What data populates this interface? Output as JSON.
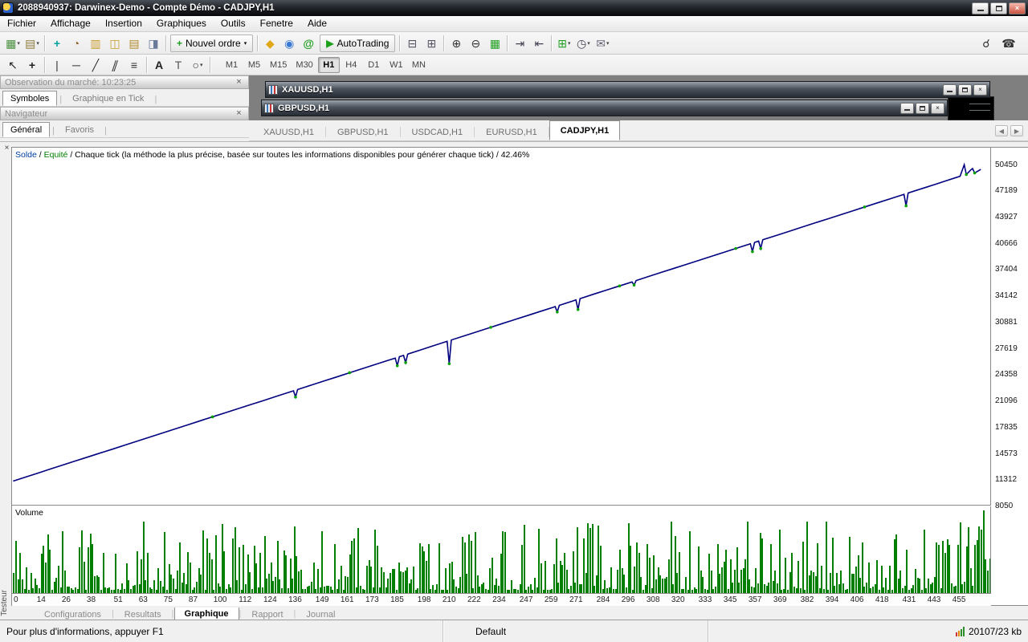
{
  "window": {
    "title": "2088940937: Darwinex-Demo - Compte Démo - CADJPY,H1"
  },
  "menu": {
    "items": [
      "Fichier",
      "Affichage",
      "Insertion",
      "Graphiques",
      "Outils",
      "Fenetre",
      "Aide"
    ]
  },
  "toolbar_main": {
    "items": [
      {
        "icon": "new-chart-icon",
        "glyph": "▦",
        "color": "#4a8f3f",
        "caret": true
      },
      {
        "icon": "profiles-icon",
        "glyph": "▤",
        "color": "#8a7a3a",
        "caret": true
      },
      {
        "sep": true
      },
      {
        "icon": "crosshair-icon",
        "glyph": "+",
        "color": "#00a0a0",
        "bold": true
      },
      {
        "icon": "compass-icon",
        "glyph": "◔",
        "color": "#996633"
      },
      {
        "icon": "market-watch-icon",
        "glyph": "▥",
        "color": "#c89a2a"
      },
      {
        "icon": "data-window-icon",
        "glyph": "◫",
        "color": "#c89a2a"
      },
      {
        "icon": "navigator-icon",
        "glyph": "▤",
        "color": "#b0882a"
      },
      {
        "icon": "terminal-icon",
        "glyph": "◨",
        "color": "#6a7a9a"
      },
      {
        "sep": true
      },
      {
        "button": "new_order"
      },
      {
        "sep": true
      },
      {
        "icon": "metaeditor-icon",
        "glyph": "◆",
        "color": "#e0a818"
      },
      {
        "icon": "community-icon",
        "glyph": "◉",
        "color": "#3a78d8"
      },
      {
        "icon": "scripts-icon",
        "glyph": "@",
        "color": "#22a022",
        "bold": true
      },
      {
        "button": "autotrading"
      },
      {
        "sep": true
      },
      {
        "icon": "tile-horizontal-icon",
        "glyph": "⊟",
        "color": "#556"
      },
      {
        "icon": "tile-vertical-icon",
        "glyph": "⊞",
        "color": "#556"
      },
      {
        "sep": true
      },
      {
        "icon": "zoom-in-icon",
        "glyph": "⊕",
        "color": "#333"
      },
      {
        "icon": "zoom-out-icon",
        "glyph": "⊖",
        "color": "#333"
      },
      {
        "icon": "maximize-chart-icon",
        "glyph": "▦",
        "color": "#22a022"
      },
      {
        "sep": true
      },
      {
        "icon": "chart-shift-icon",
        "glyph": "⇥",
        "color": "#445"
      },
      {
        "icon": "auto-scroll-icon",
        "glyph": "⇤",
        "color": "#445"
      },
      {
        "sep": true
      },
      {
        "icon": "add-indicator-icon",
        "glyph": "⊞",
        "color": "#22a022",
        "caret": true
      },
      {
        "icon": "periods-icon",
        "glyph": "◷",
        "color": "#445",
        "caret": true
      },
      {
        "icon": "mail-icon",
        "glyph": "✉",
        "color": "#667",
        "caret": true
      }
    ],
    "buttons": {
      "new_order": {
        "name": "new-order-button",
        "icon": "plus-icon",
        "glyph": "+",
        "icon_color": "#1f9e1f",
        "label": "Nouvel ordre",
        "caret": true
      },
      "autotrading": {
        "name": "autotrading-button",
        "icon": "play-icon",
        "glyph": "▶",
        "icon_color": "#1da11d",
        "label": "AutoTrading",
        "caret": false
      }
    },
    "right_icons": [
      {
        "icon": "search-icon",
        "glyph": "☌",
        "color": "#333"
      },
      {
        "icon": "support-phone-icon",
        "glyph": "☎",
        "color": "#333"
      }
    ]
  },
  "toolbar_draw": {
    "tools": [
      {
        "icon": "cursor-icon",
        "glyph": "↖",
        "color": "#222"
      },
      {
        "icon": "crosshair-tool-icon",
        "glyph": "+",
        "color": "#222",
        "bold": true
      },
      {
        "sep": true
      },
      {
        "icon": "vertical-line-icon",
        "glyph": "|",
        "color": "#333"
      },
      {
        "icon": "horizontal-line-icon",
        "glyph": "─",
        "color": "#333"
      },
      {
        "icon": "trendline-icon",
        "glyph": "╱",
        "color": "#333"
      },
      {
        "icon": "channel-icon",
        "glyph": "∥",
        "color": "#333",
        "skew": true
      },
      {
        "icon": "fibonacci-icon",
        "glyph": "≡",
        "color": "#333"
      },
      {
        "sep": true
      },
      {
        "icon": "text-icon",
        "glyph": "A",
        "color": "#222",
        "bold": true
      },
      {
        "icon": "label-icon",
        "glyph": "T",
        "color": "#555"
      },
      {
        "icon": "shapes-icon",
        "glyph": "○",
        "color": "#333",
        "caret": true
      },
      {
        "sep": true
      }
    ],
    "timeframes": [
      "M1",
      "M5",
      "M15",
      "M30",
      "H1",
      "H4",
      "D1",
      "W1",
      "MN"
    ],
    "active_timeframe": "H1"
  },
  "market_watch": {
    "title": "Observation du marché: 10:23:25",
    "tabs": [
      "Symboles",
      "Graphique en Tick"
    ],
    "active_tab": "Symboles"
  },
  "navigator": {
    "title": "Navigateur",
    "tabs": [
      "Général",
      "Favoris"
    ],
    "active_tab": "Général"
  },
  "mdi": {
    "windows": [
      {
        "title": "XAUUSD,H1"
      },
      {
        "title": "GBPUSD,H1"
      }
    ]
  },
  "chart_tabs": {
    "tabs": [
      "XAUUSD,H1",
      "GBPUSD,H1",
      "USDCAD,H1",
      "EURUSD,H1",
      "CADJPY,H1"
    ],
    "active": "CADJPY,H1"
  },
  "tester": {
    "panel_label": "Testeur",
    "header_segments": [
      {
        "text": "Solde",
        "color": "#0040a0"
      },
      {
        "text": " / ",
        "color": "#000000"
      },
      {
        "text": "Equité",
        "color": "#008000"
      },
      {
        "text": " / Chaque tick (la méthode la plus précise, basée sur toutes les informations disponibles pour générer chaque tick) / 42.46%",
        "color": "#000000"
      }
    ],
    "volume_label": "Volume",
    "tabs": [
      "Configurations",
      "Resultats",
      "Graphique",
      "Rapport",
      "Journal"
    ],
    "active_tab": "Graphique"
  },
  "chart_data": {
    "type": "line",
    "title": "Solde / Equité / Chaque tick (la méthode la plus précise, basée sur toutes les informations disponibles pour générer chaque tick) / 42.46%",
    "legend": false,
    "grid": false,
    "xlim": [
      0,
      470
    ],
    "ylim": [
      8050,
      52500
    ],
    "x_ticks": [
      0,
      14,
      26,
      38,
      51,
      63,
      75,
      87,
      100,
      112,
      124,
      136,
      149,
      161,
      173,
      185,
      198,
      210,
      222,
      234,
      247,
      259,
      271,
      284,
      296,
      308,
      320,
      333,
      345,
      357,
      369,
      382,
      394,
      406,
      418,
      431,
      443,
      455
    ],
    "y_ticks": [
      50450,
      47189,
      43927,
      40666,
      37404,
      34142,
      30881,
      27619,
      24358,
      21096,
      17835,
      14573,
      11312,
      8050
    ],
    "series": [
      {
        "name": "Solde",
        "color": "#00007f",
        "points": [
          [
            0,
            11000
          ],
          [
            6,
            11500
          ],
          [
            12,
            12000
          ],
          [
            18,
            12500
          ],
          [
            24,
            13000
          ],
          [
            30,
            13500
          ],
          [
            36,
            14000
          ],
          [
            42,
            14500
          ],
          [
            48,
            14990
          ],
          [
            54,
            15490
          ],
          [
            60,
            15990
          ],
          [
            66,
            16490
          ],
          [
            72,
            16990
          ],
          [
            78,
            17490
          ],
          [
            84,
            17990
          ],
          [
            90,
            18490
          ],
          [
            96,
            18990
          ],
          [
            102,
            19490
          ],
          [
            108,
            19990
          ],
          [
            114,
            20490
          ],
          [
            120,
            20980
          ],
          [
            126,
            21480
          ],
          [
            132,
            21980
          ],
          [
            135,
            22230
          ],
          [
            136,
            21450
          ],
          [
            137,
            22400
          ],
          [
            144,
            22980
          ],
          [
            150,
            23480
          ],
          [
            156,
            23980
          ],
          [
            162,
            24480
          ],
          [
            168,
            24980
          ],
          [
            174,
            25480
          ],
          [
            180,
            25980
          ],
          [
            184,
            26310
          ],
          [
            185,
            25350
          ],
          [
            186,
            26480
          ],
          [
            188,
            26640
          ],
          [
            189,
            25750
          ],
          [
            190,
            26810
          ],
          [
            196,
            27310
          ],
          [
            202,
            27810
          ],
          [
            208,
            28310
          ],
          [
            209,
            28390
          ],
          [
            210,
            25600
          ],
          [
            211,
            28560
          ],
          [
            218,
            29140
          ],
          [
            224,
            29640
          ],
          [
            230,
            30140
          ],
          [
            236,
            30640
          ],
          [
            242,
            31130
          ],
          [
            248,
            31630
          ],
          [
            254,
            32130
          ],
          [
            260,
            32630
          ],
          [
            261,
            32720
          ],
          [
            262,
            32050
          ],
          [
            263,
            32880
          ],
          [
            270,
            33460
          ],
          [
            271,
            33550
          ],
          [
            272,
            32350
          ],
          [
            273,
            33710
          ],
          [
            280,
            34300
          ],
          [
            286,
            34800
          ],
          [
            292,
            35290
          ],
          [
            298,
            35790
          ],
          [
            299,
            35400
          ],
          [
            300,
            35960
          ],
          [
            306,
            36460
          ],
          [
            312,
            36960
          ],
          [
            318,
            37460
          ],
          [
            324,
            37960
          ],
          [
            330,
            38460
          ],
          [
            336,
            38960
          ],
          [
            342,
            39450
          ],
          [
            348,
            39950
          ],
          [
            354,
            40450
          ],
          [
            355,
            40540
          ],
          [
            356,
            39550
          ],
          [
            357,
            40700
          ],
          [
            359,
            40870
          ],
          [
            360,
            39950
          ],
          [
            361,
            41040
          ],
          [
            368,
            41620
          ],
          [
            374,
            42120
          ],
          [
            380,
            42620
          ],
          [
            386,
            43120
          ],
          [
            392,
            43610
          ],
          [
            398,
            44110
          ],
          [
            404,
            44610
          ],
          [
            410,
            45110
          ],
          [
            416,
            45610
          ],
          [
            422,
            46110
          ],
          [
            428,
            46610
          ],
          [
            429,
            46690
          ],
          [
            430,
            45250
          ],
          [
            431,
            46860
          ],
          [
            438,
            47440
          ],
          [
            444,
            47940
          ],
          [
            450,
            48440
          ],
          [
            454,
            48770
          ],
          [
            456,
            48940
          ],
          [
            458,
            50380
          ],
          [
            459,
            49150
          ],
          [
            461,
            49700
          ],
          [
            462,
            49900
          ],
          [
            463,
            49350
          ],
          [
            466,
            49800
          ]
        ]
      }
    ],
    "markers": {
      "name": "Equité",
      "color": "#00a000",
      "points": [
        [
          96,
          18990
        ],
        [
          136,
          21450
        ],
        [
          162,
          24480
        ],
        [
          185,
          25350
        ],
        [
          189,
          25750
        ],
        [
          210,
          25600
        ],
        [
          230,
          30140
        ],
        [
          262,
          32050
        ],
        [
          272,
          32350
        ],
        [
          292,
          35290
        ],
        [
          299,
          35400
        ],
        [
          348,
          39950
        ],
        [
          356,
          39550
        ],
        [
          360,
          39950
        ],
        [
          410,
          45110
        ],
        [
          430,
          45250
        ],
        [
          459,
          49150
        ],
        [
          463,
          49350
        ]
      ]
    },
    "volume": {
      "type": "bar",
      "color": "#007f00",
      "count": 460,
      "seed": 20107,
      "base_fraction": 0.04,
      "spread": 0.8,
      "power": 2.4,
      "tall_bars": [
        {
          "index": 456,
          "fraction": 0.97
        },
        {
          "index": 448,
          "fraction": 0.55
        }
      ]
    }
  },
  "status_bar": {
    "help": "Pour plus d'informations, appuyer F1",
    "profile": "Default",
    "size": "20107/23 kb"
  }
}
